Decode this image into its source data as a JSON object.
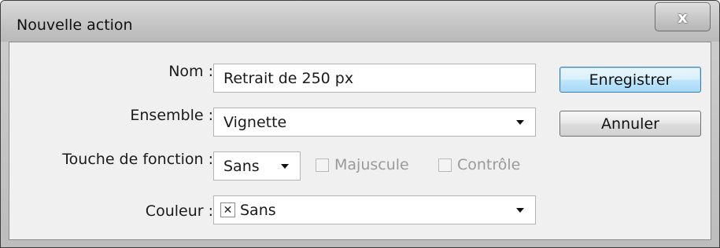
{
  "window": {
    "title": "Nouvelle action",
    "close_glyph": "x"
  },
  "form": {
    "name": {
      "label": "Nom :",
      "value": "Retrait de 250 px"
    },
    "set": {
      "label": "Ensemble :",
      "value": "Vignette"
    },
    "function_key": {
      "label": "Touche de fonction :",
      "value": "Sans",
      "shift_label": "Majuscule",
      "shift_checked": false,
      "control_label": "Contrôle",
      "control_checked": false
    },
    "color": {
      "label": "Couleur :",
      "value": "Sans",
      "icon": "x-mark-icon"
    }
  },
  "buttons": {
    "save": "Enregistrer",
    "cancel": "Annuler"
  }
}
